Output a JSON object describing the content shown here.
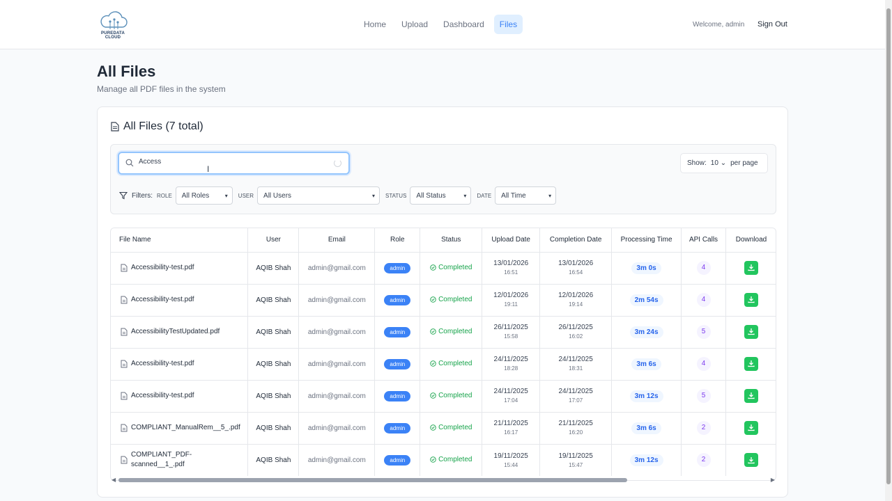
{
  "header": {
    "logo_text": "PUREDATA CLOUD",
    "nav": [
      {
        "label": "Home",
        "active": false
      },
      {
        "label": "Upload",
        "active": false
      },
      {
        "label": "Dashboard",
        "active": false
      },
      {
        "label": "Files",
        "active": true
      }
    ],
    "welcome": "Welcome, admin",
    "sign_out": "Sign Out"
  },
  "page": {
    "title": "All Files",
    "subtitle": "Manage all PDF files in the system"
  },
  "card": {
    "title": "All Files (7 total)",
    "search": {
      "value": "Access"
    },
    "show": {
      "label": "Show:",
      "value": "10",
      "suffix": "per page"
    },
    "filters": {
      "label": "Filters:",
      "role": {
        "tag": "ROLE",
        "value": "All Roles"
      },
      "user": {
        "tag": "USER",
        "value": "All Users"
      },
      "status": {
        "tag": "STATUS",
        "value": "All Status"
      },
      "date": {
        "tag": "DATE",
        "value": "All Time"
      }
    }
  },
  "table": {
    "columns": [
      "File Name",
      "User",
      "Email",
      "Role",
      "Status",
      "Upload Date",
      "Completion Date",
      "Processing Time",
      "API Calls",
      "Download"
    ],
    "rows": [
      {
        "file": "Accessibility-test.pdf",
        "user": "AQIB Shah",
        "email": "admin@gmail.com",
        "role": "admin",
        "status": "Completed",
        "upload_date": "13/01/2026",
        "upload_time": "16:51",
        "complete_date": "13/01/2026",
        "complete_time": "16:54",
        "ptime": "3m 0s",
        "api": "4"
      },
      {
        "file": "Accessibility-test.pdf",
        "user": "AQIB Shah",
        "email": "admin@gmail.com",
        "role": "admin",
        "status": "Completed",
        "upload_date": "12/01/2026",
        "upload_time": "19:11",
        "complete_date": "12/01/2026",
        "complete_time": "19:14",
        "ptime": "2m 54s",
        "api": "4"
      },
      {
        "file": "AccessibilityTestUpdated.pdf",
        "user": "AQIB Shah",
        "email": "admin@gmail.com",
        "role": "admin",
        "status": "Completed",
        "upload_date": "26/11/2025",
        "upload_time": "15:58",
        "complete_date": "26/11/2025",
        "complete_time": "16:02",
        "ptime": "3m 24s",
        "api": "5"
      },
      {
        "file": "Accessibility-test.pdf",
        "user": "AQIB Shah",
        "email": "admin@gmail.com",
        "role": "admin",
        "status": "Completed",
        "upload_date": "24/11/2025",
        "upload_time": "18:28",
        "complete_date": "24/11/2025",
        "complete_time": "18:31",
        "ptime": "3m 6s",
        "api": "4"
      },
      {
        "file": "Accessibility-test.pdf",
        "user": "AQIB Shah",
        "email": "admin@gmail.com",
        "role": "admin",
        "status": "Completed",
        "upload_date": "24/11/2025",
        "upload_time": "17:04",
        "complete_date": "24/11/2025",
        "complete_time": "17:07",
        "ptime": "3m 12s",
        "api": "5"
      },
      {
        "file": "COMPLIANT_ManualRem__5_.pdf",
        "user": "AQIB Shah",
        "email": "admin@gmail.com",
        "role": "admin",
        "status": "Completed",
        "upload_date": "21/11/2025",
        "upload_time": "16:17",
        "complete_date": "21/11/2025",
        "complete_time": "16:20",
        "ptime": "3m 6s",
        "api": "2"
      },
      {
        "file": "COMPLIANT_PDF-scanned__1_.pdf",
        "user": "AQIB Shah",
        "email": "admin@gmail.com",
        "role": "admin",
        "status": "Completed",
        "upload_date": "19/11/2025",
        "upload_time": "15:44",
        "complete_date": "19/11/2025",
        "complete_time": "15:47",
        "ptime": "3m 12s",
        "api": "2"
      }
    ]
  },
  "colors": {
    "accent": "#3b82f6",
    "success": "#16a34a",
    "download": "#22c55e",
    "api": "#7c3aed"
  }
}
